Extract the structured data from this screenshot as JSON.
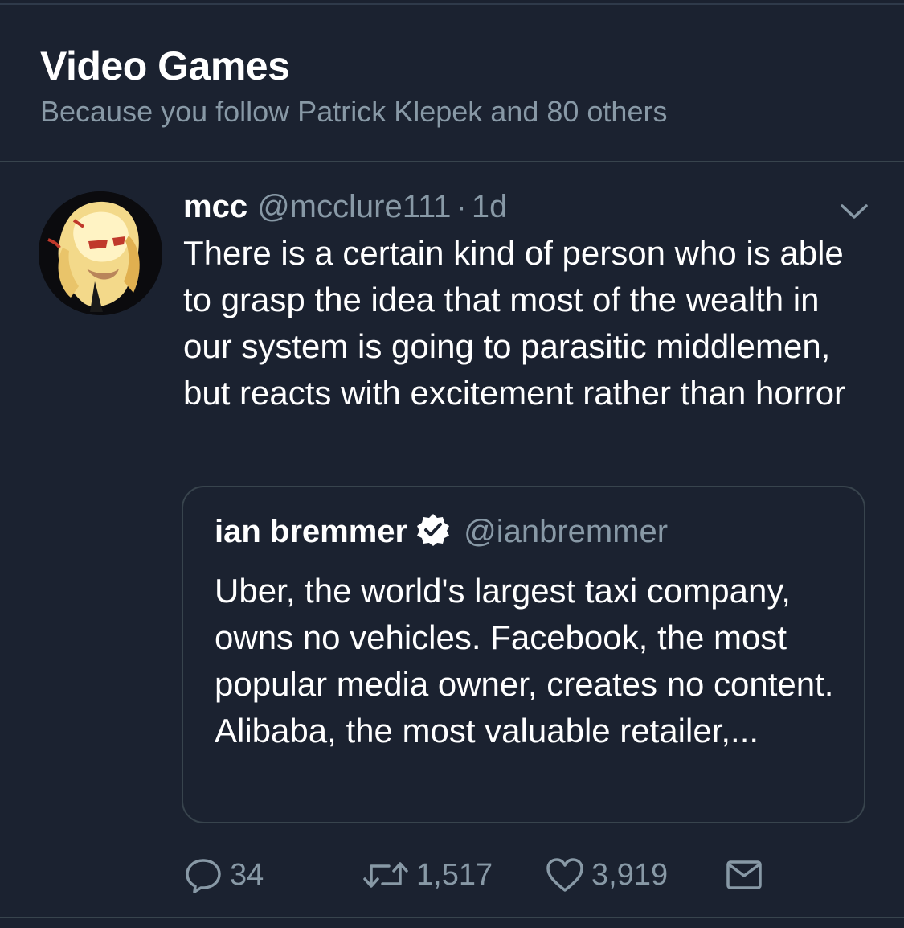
{
  "section": {
    "title": "Video Games",
    "subtitle": "Because you follow Patrick Klepek and 80 others"
  },
  "tweet": {
    "author_name": "mcc",
    "author_handle": "@mcclure111",
    "separator": "·",
    "time_ago": "1d",
    "text": "There is a certain kind of person who is able to grasp the idea that most of the wealth in our system is going to parasitic middlemen, but reacts with excitement rather than horror",
    "quoted": {
      "author_name": "ian bremmer",
      "author_handle": "@ianbremmer",
      "verified": true,
      "text": "Uber, the world's largest taxi company, owns no vehicles. Facebook, the most popular media owner, creates no content. Alibaba, the most valuable retailer,..."
    },
    "actions": {
      "replies": "34",
      "retweets": "1,517",
      "likes": "3,919"
    }
  },
  "icons": {
    "caret": "chevron-down-icon",
    "reply": "reply-bubble-icon",
    "retweet": "retweet-icon",
    "like": "heart-icon",
    "message": "envelope-icon",
    "verified": "verified-badge-icon"
  },
  "colors": {
    "background": "#1b2230",
    "secondary_text": "#8899a6",
    "border": "#38444d"
  }
}
